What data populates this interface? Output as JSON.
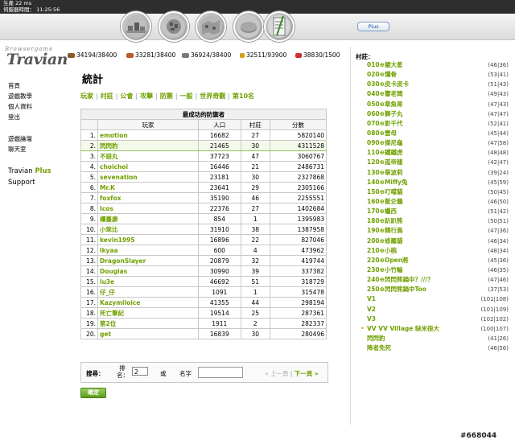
{
  "topbar": {
    "ms_label": "生產 22 ms",
    "server_time": "伺服器時間： 11:25:56"
  },
  "nav": {
    "icons": [
      "village-overview-icon",
      "village-center-icon",
      "map-icon",
      "statistics-icon",
      "reports-icon",
      "messages-icon"
    ],
    "plus_button": "Plus"
  },
  "logo": {
    "small_text": "Browsergame",
    "text": "Travian"
  },
  "resources": [
    {
      "name": "wood",
      "icon": "wood-icon",
      "value": "34194/38400",
      "color": "#8a5a2b"
    },
    {
      "name": "clay",
      "icon": "clay-icon",
      "value": "33281/38400",
      "color": "#b85c2c"
    },
    {
      "name": "iron",
      "icon": "iron-icon",
      "value": "36924/38400",
      "color": "#7a7a7a"
    },
    {
      "name": "crop",
      "icon": "crop-icon",
      "value": "32511/93900",
      "color": "#d4a017"
    },
    {
      "name": "consumption",
      "icon": "consumption-icon",
      "value": "38830/1500",
      "color": "#c83232"
    }
  ],
  "left_menu": {
    "items": [
      "首頁",
      "遊戲教學",
      "個人資料",
      "登出"
    ],
    "items2": [
      "遊戲論壇",
      "聊天室"
    ],
    "plus_label_1": "Travian ",
    "plus_label_2": "Plus",
    "support": "Support"
  },
  "page_title": "統計",
  "tabs": [
    "玩家",
    "村莊",
    "公會",
    "攻擊",
    "防禦",
    "一般",
    "世界奇觀",
    "第10名"
  ],
  "table": {
    "caption": "最成功的防禦者",
    "headers": [
      "玩家",
      "人口",
      "村莊",
      "分數"
    ],
    "rows": [
      {
        "rank": "1.",
        "player": "emotion",
        "pop": "16682",
        "villages": "27",
        "score": "5820140"
      },
      {
        "rank": "2.",
        "player": "閃閃豹",
        "pop": "21465",
        "villages": "30",
        "score": "4311528"
      },
      {
        "rank": "3.",
        "player": "不惡丸",
        "pop": "37723",
        "villages": "47",
        "score": "3060767"
      },
      {
        "rank": "4.",
        "player": "choichoi",
        "pop": "16446",
        "villages": "21",
        "score": "2486731"
      },
      {
        "rank": "5.",
        "player": "sevenation",
        "pop": "23181",
        "villages": "30",
        "score": "2327868"
      },
      {
        "rank": "6.",
        "player": "Mr.K",
        "pop": "23641",
        "villages": "29",
        "score": "2305166"
      },
      {
        "rank": "7.",
        "player": "foxfox",
        "pop": "35190",
        "villages": "46",
        "score": "2255551"
      },
      {
        "rank": "8.",
        "player": "Icos",
        "pop": "22376",
        "villages": "27",
        "score": "1402684"
      },
      {
        "rank": "9.",
        "player": "櫃臺康",
        "pop": "854",
        "villages": "1",
        "score": "1395983"
      },
      {
        "rank": "10.",
        "player": "小笨比",
        "pop": "31910",
        "villages": "38",
        "score": "1387958"
      },
      {
        "rank": "11.",
        "player": "kevin1995",
        "pop": "16896",
        "villages": "22",
        "score": "827046"
      },
      {
        "rank": "12.",
        "player": "lkyaa",
        "pop": "600",
        "villages": "4",
        "score": "473962"
      },
      {
        "rank": "13.",
        "player": "DragonSlayer",
        "pop": "20879",
        "villages": "32",
        "score": "419744"
      },
      {
        "rank": "14.",
        "player": "Douglas",
        "pop": "30990",
        "villages": "39",
        "score": "337382"
      },
      {
        "rank": "15.",
        "player": "lu3e",
        "pop": "46692",
        "villages": "51",
        "score": "318729"
      },
      {
        "rank": "16.",
        "player": "仔_仔",
        "pop": "1091",
        "villages": "1",
        "score": "315478"
      },
      {
        "rank": "17.",
        "player": "Kazymiloice",
        "pop": "41355",
        "villages": "44",
        "score": "298194"
      },
      {
        "rank": "18.",
        "player": "死亡筆記",
        "pop": "19514",
        "villages": "25",
        "score": "287361"
      },
      {
        "rank": "19.",
        "player": "第2位",
        "pop": "1911",
        "villages": "2",
        "score": "282337"
      },
      {
        "rank": "20.",
        "player": "get",
        "pop": "16839",
        "villages": "30",
        "score": "280496"
      }
    ]
  },
  "search": {
    "label": "搜尋：",
    "rank_label": "排名：",
    "rank_value": "2",
    "or_label": "或",
    "name_label": "名字",
    "prev": "« 上一頁",
    "pager_sep": "|",
    "next": "下一頁 »",
    "ok_button": "確定"
  },
  "villages": {
    "heading": "村莊：",
    "items": [
      {
        "name": "010⊕鍍大星",
        "coords": "(46|36)"
      },
      {
        "name": "020⊕爛骨",
        "coords": "(53|41)"
      },
      {
        "name": "030⊕皮卡皮卡",
        "coords": "(51|43)"
      },
      {
        "name": "040⊕響老闆",
        "coords": "(49|43)"
      },
      {
        "name": "050⊕章魚哥",
        "coords": "(47|43)"
      },
      {
        "name": "060⊕獅子丸",
        "coords": "(47|47)"
      },
      {
        "name": "070⊕影千代",
        "coords": "(52|41)"
      },
      {
        "name": "080⊕雲母",
        "coords": "(45|44)"
      },
      {
        "name": "090⊕傑尼龜",
        "coords": "(47|58)"
      },
      {
        "name": "110⊕鐵鐵虎",
        "coords": "(48|48)"
      },
      {
        "name": "120⊕孤帝龍",
        "coords": "(42|47)"
      },
      {
        "name": "130⊕華波莉",
        "coords": "(39|24)"
      },
      {
        "name": "140⊕Miffy兔",
        "coords": "(45|59)"
      },
      {
        "name": "150⊕叮噹貓",
        "coords": "(50|45)"
      },
      {
        "name": "160⊕藍企鵝",
        "coords": "(46|50)"
      },
      {
        "name": "170⊕蠟西",
        "coords": "(51|42)"
      },
      {
        "name": "180⊕趴趴熊",
        "coords": "(50|51)"
      },
      {
        "name": "190⊕韓行鳥",
        "coords": "(47|36)"
      },
      {
        "name": "200⊕修羅貓",
        "coords": "(46|34)"
      },
      {
        "name": "210⊕小桃",
        "coords": "(48|34)"
      },
      {
        "name": "220⊕Open將",
        "coords": "(45|36)"
      },
      {
        "name": "230⊕小竹輪",
        "coords": "(46|35)"
      },
      {
        "name": "240⊕閃閃熊鍋中？///？",
        "coords": "(47|46)"
      },
      {
        "name": "250⊕閃閃熊鍋中Too",
        "coords": "(37|53)"
      },
      {
        "name": "V1",
        "coords": "(101|108)"
      },
      {
        "name": "V2",
        "coords": "(101|109)"
      },
      {
        "name": "V3",
        "coords": "(102|102)"
      },
      {
        "name": "VV VV Village 缺米很大",
        "coords": "(100|107)",
        "active": true
      },
      {
        "name": "閃閃豹",
        "coords": "(41|26)"
      },
      {
        "name": "降者免死",
        "coords": "(46|56)"
      }
    ]
  },
  "watermark": "#668044"
}
